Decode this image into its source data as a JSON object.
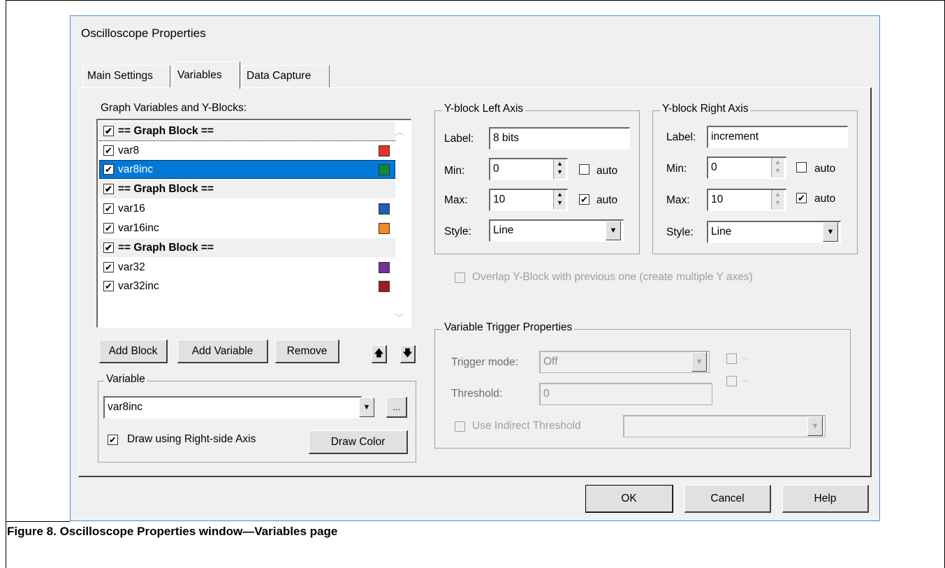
{
  "dialog": {
    "title": "Oscilloscope Properties"
  },
  "tabs": [
    {
      "label": "Main Settings",
      "active": false
    },
    {
      "label": "Variables",
      "active": true
    },
    {
      "label": "Data Capture",
      "active": false
    }
  ],
  "variables_panel": {
    "list_label": "Graph Variables and Y-Blocks:",
    "list_items": [
      {
        "label": "== Graph Block ==",
        "kind": "block",
        "checked": true
      },
      {
        "label": "var8",
        "kind": "variable",
        "checked": true,
        "color": "#e8302a"
      },
      {
        "label": "var8inc",
        "kind": "variable",
        "checked": true,
        "color": "#0a8a3c",
        "selected": true
      },
      {
        "label": "== Graph Block ==",
        "kind": "block",
        "checked": true
      },
      {
        "label": "var16",
        "kind": "variable",
        "checked": true,
        "color": "#1e5fb4"
      },
      {
        "label": "var16inc",
        "kind": "variable",
        "checked": true,
        "color": "#f28a1e"
      },
      {
        "label": "== Graph Block ==",
        "kind": "block",
        "checked": true
      },
      {
        "label": "var32",
        "kind": "variable",
        "checked": true,
        "color": "#7030a0"
      },
      {
        "label": "var32inc",
        "kind": "variable",
        "checked": true,
        "color": "#a01b22"
      }
    ],
    "buttons": {
      "add_block": "Add Block",
      "add_variable": "Add Variable",
      "remove": "Remove",
      "move_up_icon": "arrow-up-icon",
      "move_down_icon": "arrow-down-icon"
    }
  },
  "variable_group": {
    "title": "Variable",
    "selected_variable": "var8inc",
    "ellipsis": "...",
    "draw_right_axis_label": "Draw using Right-side Axis",
    "draw_right_axis_checked": true,
    "draw_color_button": "Draw Color"
  },
  "left_axis": {
    "title": "Y-block Left Axis",
    "label_caption": "Label:",
    "label_value": "8 bits",
    "min_caption": "Min:",
    "min_value": "0",
    "min_auto_label": "auto",
    "min_auto": false,
    "max_caption": "Max:",
    "max_value": "10",
    "max_auto_label": "auto",
    "max_auto": true,
    "style_caption": "Style:",
    "style_value": "Line"
  },
  "right_axis": {
    "title": "Y-block Right Axis",
    "label_caption": "Label:",
    "label_value": "increment",
    "min_caption": "Min:",
    "min_value": "0",
    "min_auto_label": "auto",
    "min_auto": false,
    "max_caption": "Max:",
    "max_value": "10",
    "max_auto_label": "auto",
    "max_auto": true,
    "style_caption": "Style:",
    "style_value": "Line"
  },
  "overlap": {
    "label": "Overlap Y-Block with previous one (create multiple Y axes)",
    "checked": false,
    "enabled": false
  },
  "trigger": {
    "title": "Variable Trigger Properties",
    "mode_caption": "Trigger mode:",
    "mode_value": "Off",
    "threshold_caption": "Threshold:",
    "threshold_value": "0",
    "indirect_label": "Use Indirect Threshold",
    "indirect_value": "",
    "side_checkbox_1": "...",
    "side_checkbox_2": "..."
  },
  "footer_buttons": {
    "ok": "OK",
    "cancel": "Cancel",
    "help": "Help"
  },
  "caption": "Figure 8. Oscilloscope Properties window—Variables page"
}
